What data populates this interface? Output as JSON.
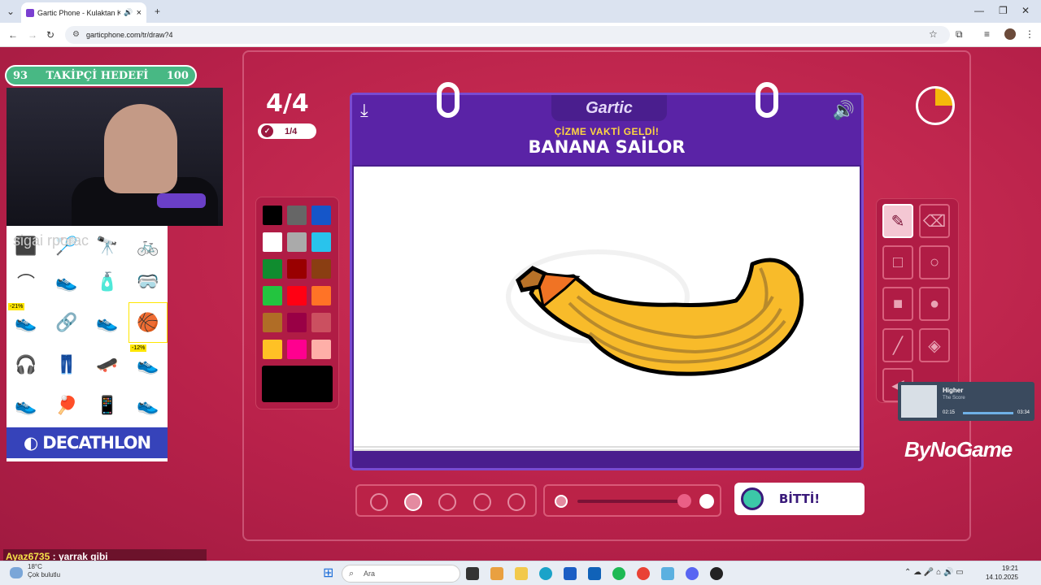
{
  "browser": {
    "tab_title": "Gartic Phone - Kulaktan Ku",
    "url": "garticphone.com/tr/draw?4"
  },
  "game": {
    "round": "4/4",
    "done_count": "1/4",
    "logo": "Gartic",
    "heading": "ÇİZME VAKTİ GELDİ!",
    "word": "BANANA SAİLOR",
    "finish_label": "BİTTİ!",
    "colors": [
      "#000000",
      "#666666",
      "#1556c9",
      "#ffffff",
      "#aaaaaa",
      "#29c3ec",
      "#108c2f",
      "#990000",
      "#8a3e12",
      "#23c43f",
      "#ff0013",
      "#ff7326",
      "#b06d26",
      "#990045",
      "#cb5060",
      "#ffc125",
      "#ff008f",
      "#feafa8"
    ],
    "current_color": "#000000",
    "timer_elapsed_fraction": 0.25
  },
  "overlay": {
    "goal_current": "93",
    "goal_label": "TAKİPÇİ HEDEFİ",
    "goal_target": "100",
    "ad_text": "sigai  rporac",
    "ad_badge1": "-21%",
    "ad_badge2": "-12%",
    "ad_brand": "DECATHLON",
    "music_title": "Higher",
    "music_artist": "The Score",
    "music_elapsed": "02:15",
    "music_total": "03:34",
    "brand": "ByNoGame",
    "chat_user": "Ayaz6735",
    "chat_msg": ": yarrak gibi"
  },
  "taskbar": {
    "temp": "18°C",
    "weather": "Çok bulutlu",
    "search_placeholder": "Ara",
    "time": "19:21",
    "date": "14.10.2025"
  }
}
